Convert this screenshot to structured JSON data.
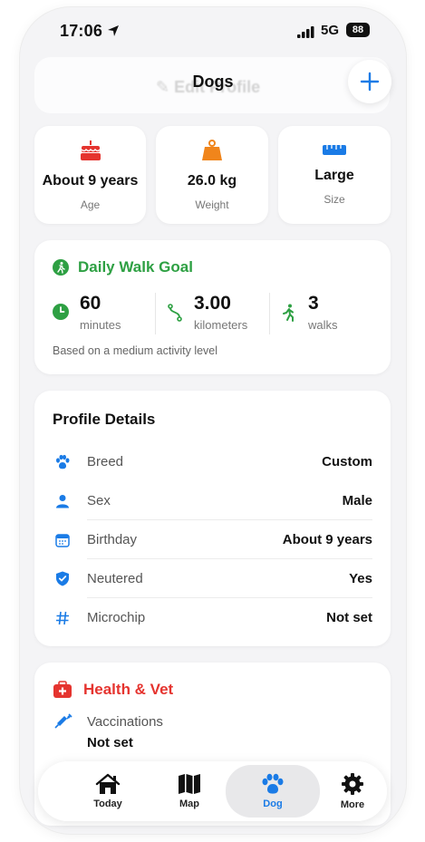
{
  "status_bar": {
    "time": "17:06",
    "network": "5G",
    "battery": "88"
  },
  "header": {
    "title": "Dogs",
    "ghost_text": "Edit Profile",
    "add_icon": "plus-icon"
  },
  "stats": [
    {
      "value": "About 9 years",
      "label": "Age",
      "icon": "cake-icon",
      "color": "#e5342f"
    },
    {
      "value": "26.0 kg",
      "label": "Weight",
      "icon": "scale-weight-icon",
      "color": "#f0851b"
    },
    {
      "value": "Large",
      "label": "Size",
      "icon": "ruler-icon",
      "color": "#1a7be6"
    }
  ],
  "walk_goal": {
    "title": "Daily Walk Goal",
    "accent": "#2ea043",
    "metrics": [
      {
        "value": "60",
        "label": "minutes",
        "icon": "clock-icon"
      },
      {
        "value": "3.00",
        "label": "kilometers",
        "icon": "route-icon"
      },
      {
        "value": "3",
        "label": "walks",
        "icon": "walker-icon"
      }
    ],
    "note": "Based on a medium activity level"
  },
  "profile": {
    "title": "Profile Details",
    "rows": [
      {
        "label": "Breed",
        "value": "Custom",
        "icon": "paw-icon"
      },
      {
        "label": "Sex",
        "value": "Male",
        "icon": "person-icon"
      },
      {
        "label": "Birthday",
        "value": "About 9 years",
        "icon": "calendar-icon"
      },
      {
        "label": "Neutered",
        "value": "Yes",
        "icon": "shield-check-icon"
      },
      {
        "label": "Microchip",
        "value": "Not set",
        "icon": "hash-icon"
      }
    ]
  },
  "health": {
    "title": "Health & Vet",
    "accent": "#e5342f",
    "vaccinations_label": "Vaccinations",
    "vaccinations_value": "Not set"
  },
  "tabbar": {
    "tabs": [
      {
        "label": "Today",
        "icon": "house-icon"
      },
      {
        "label": "Map",
        "icon": "map-icon"
      },
      {
        "label": "Dog",
        "icon": "paw-icon",
        "active": true
      },
      {
        "label": "More",
        "icon": "gear-icon"
      }
    ],
    "accent": "#1a7be6"
  }
}
